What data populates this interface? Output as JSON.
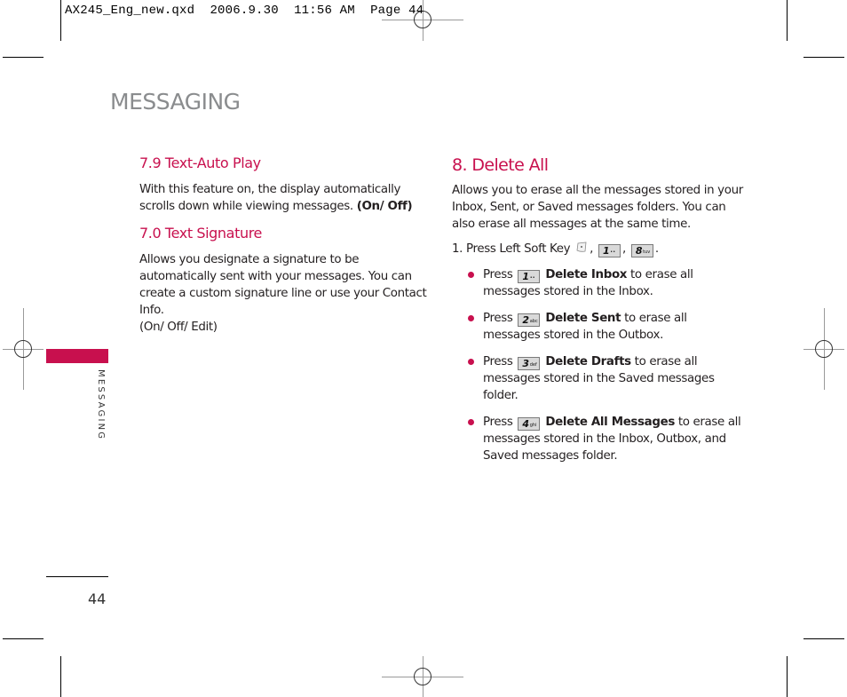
{
  "slug": {
    "filename": "AX245_Eng_new.qxd",
    "date": "2006.9.30",
    "time": "11:56 AM",
    "page_label": "Page 44"
  },
  "page_title": "MESSAGING",
  "side_tab": {
    "label": "MESSAGING",
    "color": "#c8104e"
  },
  "page_number": "44",
  "left_column": {
    "sections": [
      {
        "heading": "7.9 Text-Auto Play",
        "body": "With this feature on, the display automatically scrolls down while viewing messages. ",
        "options": "(On/ Off)"
      },
      {
        "heading": "7.0 Text Signature",
        "body": "Allows you designate a signature to be automatically sent with your messages. You can create a custom signature line or use your Contact Info.",
        "options": "(On/ Off/ Edit)"
      }
    ]
  },
  "right_column": {
    "heading": "8. Delete All",
    "intro": "Allows you to erase all the messages stored in your Inbox, Sent, or Saved messages folders. You can also erase all messages at the same time.",
    "step": {
      "text": "1. Press Left Soft Key",
      "keys": [
        {
          "icon": "left-soft-key-icon"
        },
        {
          "digit": "1",
          "letters": "••"
        },
        {
          "digit": "8",
          "letters": "tuv"
        }
      ]
    },
    "bullets": [
      {
        "press": "Press",
        "key_digit": "1",
        "key_letters": "••",
        "option": "Delete Inbox",
        "desc": " to erase all messages stored in the Inbox."
      },
      {
        "press": "Press",
        "key_digit": "2",
        "key_letters": "abc",
        "option": "Delete Sent",
        "desc": " to erase all messages stored in the Outbox."
      },
      {
        "press": "Press",
        "key_digit": "3",
        "key_letters": "def",
        "option": "Delete Drafts",
        "desc": " to erase all messages stored in the Saved messages folder."
      },
      {
        "press": "Press",
        "key_digit": "4",
        "key_letters": "ghi",
        "option": "Delete All Messages",
        "desc": " to erase all messages stored in the Inbox, Outbox, and Saved messages folder."
      }
    ],
    "accent_color": "#c8104e"
  }
}
